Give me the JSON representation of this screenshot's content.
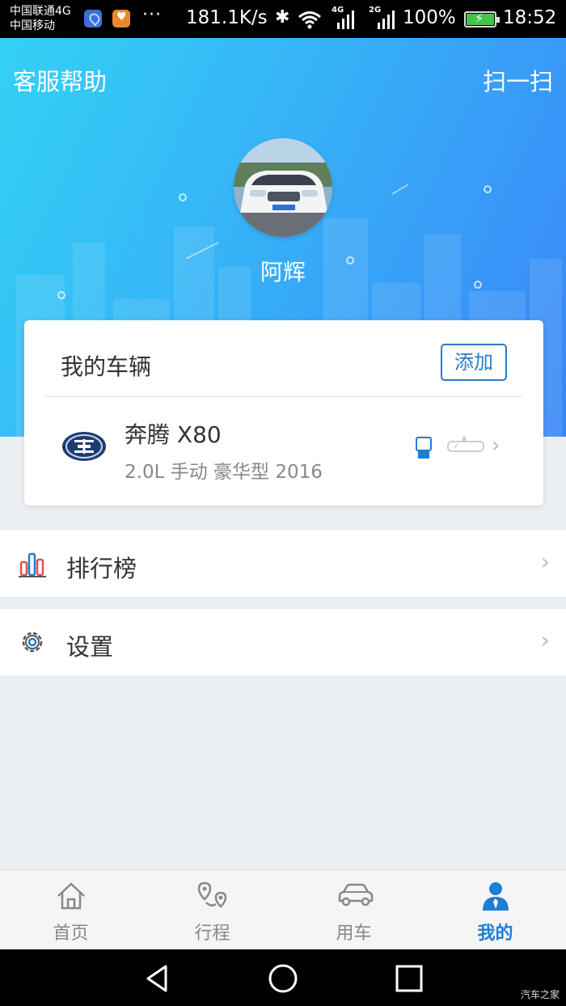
{
  "status_bar": {
    "carrier_1": "中国联通4G",
    "carrier_2": "中国移动",
    "dots": "···",
    "net_speed": "181.1K/s",
    "bluetooth": "✱",
    "sim1_tag": "4G",
    "sim2_tag": "2G",
    "battery_percent": "100%",
    "time": "18:52",
    "battery_color": "#48c24a"
  },
  "header": {
    "left_link": "客服帮助",
    "right_link": "扫一扫",
    "username": "阿辉"
  },
  "vehicle_card": {
    "title": "我的车辆",
    "add_button": "添加",
    "car_name": "奔腾 X80",
    "car_spec": "2.0L 手动 豪华型 2016",
    "arrow": "›"
  },
  "menu": [
    {
      "label": "排行榜",
      "icon": "bar-chart-icon",
      "arrow": "›"
    },
    {
      "label": "设置",
      "icon": "gear-icon",
      "arrow": "›"
    }
  ],
  "tabs": [
    {
      "label": "首页",
      "icon": "home-icon",
      "active": false
    },
    {
      "label": "行程",
      "icon": "route-icon",
      "active": false
    },
    {
      "label": "用车",
      "icon": "car-icon",
      "active": false
    },
    {
      "label": "我的",
      "icon": "person-icon",
      "active": true
    }
  ],
  "watermark": "汽车之家",
  "colors": {
    "accent": "#1c7ed6",
    "hero_start": "#34d1f4",
    "hero_end": "#3a86f8",
    "background": "#eceff2"
  }
}
